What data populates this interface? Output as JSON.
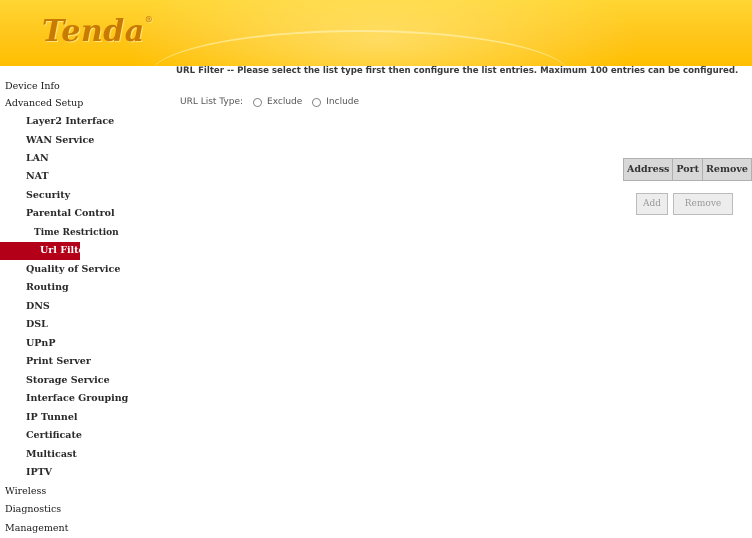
{
  "header": {
    "logo_text": "Tenda",
    "logo_reg": "®"
  },
  "sidebar": {
    "items": [
      {
        "label": "Device Info",
        "level": 0
      },
      {
        "label": "Advanced Setup",
        "level": 0
      },
      {
        "label": "Layer2 Interface",
        "level": 1
      },
      {
        "label": "WAN Service",
        "level": 1
      },
      {
        "label": "LAN",
        "level": 1
      },
      {
        "label": "NAT",
        "level": 1
      },
      {
        "label": "Security",
        "level": 1
      },
      {
        "label": "Parental Control",
        "level": 1
      },
      {
        "label": "Time Restriction",
        "level": 2
      },
      {
        "label": "Url Filter",
        "level": 2,
        "active": true
      },
      {
        "label": "Quality of Service",
        "level": 1
      },
      {
        "label": "Routing",
        "level": 1
      },
      {
        "label": "DNS",
        "level": 1
      },
      {
        "label": "DSL",
        "level": 1
      },
      {
        "label": "UPnP",
        "level": 1
      },
      {
        "label": "Print Server",
        "level": 1
      },
      {
        "label": "Storage Service",
        "level": 1
      },
      {
        "label": "Interface Grouping",
        "level": 1
      },
      {
        "label": "IP Tunnel",
        "level": 1
      },
      {
        "label": "Certificate",
        "level": 1
      },
      {
        "label": "Multicast",
        "level": 1
      },
      {
        "label": "IPTV",
        "level": 1
      },
      {
        "label": "Wireless",
        "level": 0
      },
      {
        "label": "Diagnostics",
        "level": 0
      },
      {
        "label": "Management",
        "level": 0
      }
    ]
  },
  "main": {
    "description": "URL Filter -- Please select the list type first then configure the list entries. Maximum 100 entries can be configured.",
    "list_type_label": "URL List Type:",
    "options": [
      {
        "label": "Exclude",
        "selected": false
      },
      {
        "label": "Include",
        "selected": false
      }
    ],
    "table_headers": [
      "Address",
      "Port",
      "Remove"
    ],
    "add_label": "Add",
    "remove_label": "Remove"
  },
  "colors": {
    "active_nav_bg": "#b30018",
    "header_yellow": "#ffc61a",
    "logo": "#c97a00"
  }
}
